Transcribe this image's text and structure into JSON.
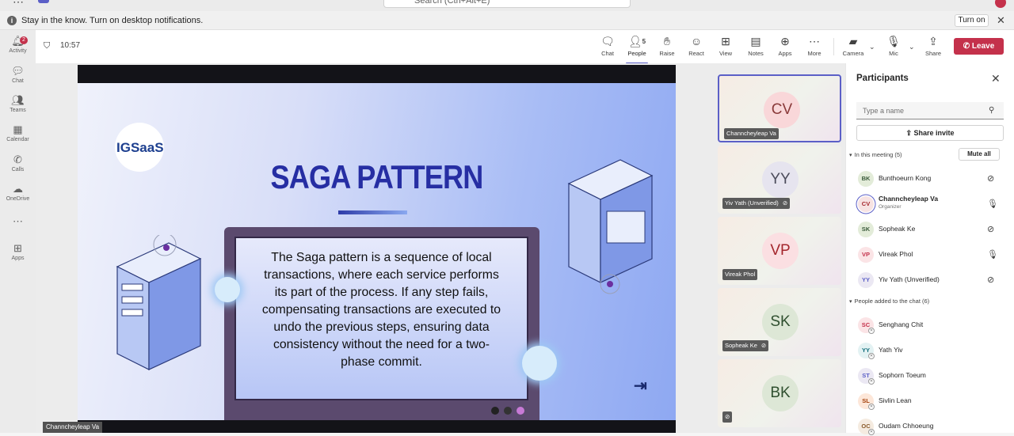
{
  "top": {
    "more": "⋯",
    "search_placeholder": "Search (Ctrl+Alt+E)"
  },
  "notification": {
    "message": "Stay in the know. Turn on desktop notifications.",
    "action": "Turn on"
  },
  "rail": {
    "items": [
      {
        "label": "Activity",
        "icon": "bell-icon",
        "badge": "2"
      },
      {
        "label": "Chat",
        "icon": "chat-icon"
      },
      {
        "label": "Teams",
        "icon": "teams-icon"
      },
      {
        "label": "Calendar",
        "icon": "calendar-icon"
      },
      {
        "label": "Calls",
        "icon": "phone-icon"
      },
      {
        "label": "OneDrive",
        "icon": "cloud-icon"
      },
      {
        "label": "",
        "icon": "more-icon"
      },
      {
        "label": "Apps",
        "icon": "apps-icon"
      }
    ]
  },
  "meeting": {
    "time": "10:57",
    "people_count": "5",
    "toolbar": {
      "chat": "Chat",
      "people": "People",
      "raise": "Raise",
      "react": "React",
      "view": "View",
      "notes": "Notes",
      "apps": "Apps",
      "more": "More",
      "camera": "Camera",
      "mic": "Mic",
      "share": "Share",
      "leave": "Leave"
    }
  },
  "slide": {
    "logo_text": "IGSaaS",
    "title": "SAGA PATTERN",
    "body": "The Saga pattern is a sequence of local transactions, where each service performs its part of the process. If any step fails, compensating transactions are executed to undo the previous steps, ensuring data consistency without the need for a two-phase commit.",
    "presenter": "Channcheyleap Va"
  },
  "tiles": [
    {
      "initials": "CV",
      "name": "Channcheyleap Va",
      "muted": false,
      "speaking": true,
      "color": "#c4485e"
    },
    {
      "initials": "YY",
      "name": "Yiv Yath (Unverified)",
      "muted": true,
      "speaking": false,
      "color": "#6b6b78"
    },
    {
      "initials": "VP",
      "name": "Vireak Phol",
      "muted": false,
      "speaking": false,
      "color": "#c4485e"
    },
    {
      "initials": "SK",
      "name": "Sopheak Ke",
      "muted": true,
      "speaking": false,
      "color": "#3a5a3a"
    },
    {
      "initials": "BK",
      "name": "",
      "muted": true,
      "speaking": false,
      "color": "#3a5a3a"
    }
  ],
  "participants": {
    "title": "Participants",
    "search_placeholder": "Type a name",
    "share_invite": "Share invite",
    "in_meeting_label": "In this meeting (5)",
    "mute_all": "Mute all",
    "in_meeting": [
      {
        "initials": "BK",
        "name": "Bunthoeurn Kong",
        "role": "",
        "mic": "muted",
        "bg": "#e3ecd9",
        "fg": "#3a5a3a"
      },
      {
        "initials": "CV",
        "name": "Channcheyleap Va",
        "role": "Organizer",
        "mic": "on",
        "bg": "#f7e3e3",
        "fg": "#a4262c"
      },
      {
        "initials": "SK",
        "name": "Sopheak Ke",
        "role": "",
        "mic": "muted",
        "bg": "#e3ecd9",
        "fg": "#3a5a3a"
      },
      {
        "initials": "VP",
        "name": "Vireak Phol",
        "role": "",
        "mic": "on",
        "bg": "#fbe4e6",
        "fg": "#c4314b"
      },
      {
        "initials": "YY",
        "name": "Yiv Yath (Unverified)",
        "role": "",
        "mic": "muted",
        "bg": "#ebe8f3",
        "fg": "#5b5fc7"
      }
    ],
    "added_label": "People added to the chat (6)",
    "added": [
      {
        "initials": "SC",
        "name": "Senghang Chit",
        "bg": "#fbe4e6",
        "fg": "#c4314b"
      },
      {
        "initials": "YY",
        "name": "Yath Yiv",
        "bg": "#e3f2f3",
        "fg": "#0f6c7a"
      },
      {
        "initials": "ST",
        "name": "Sophorn Toeum",
        "bg": "#ebe8f3",
        "fg": "#5b5fc7"
      },
      {
        "initials": "SL",
        "name": "Sivlin Lean",
        "bg": "#fde7d9",
        "fg": "#a4410b"
      },
      {
        "initials": "OC",
        "name": "Oudam Chhoeung",
        "bg": "#f5ebe0",
        "fg": "#8a5a2a"
      }
    ]
  }
}
